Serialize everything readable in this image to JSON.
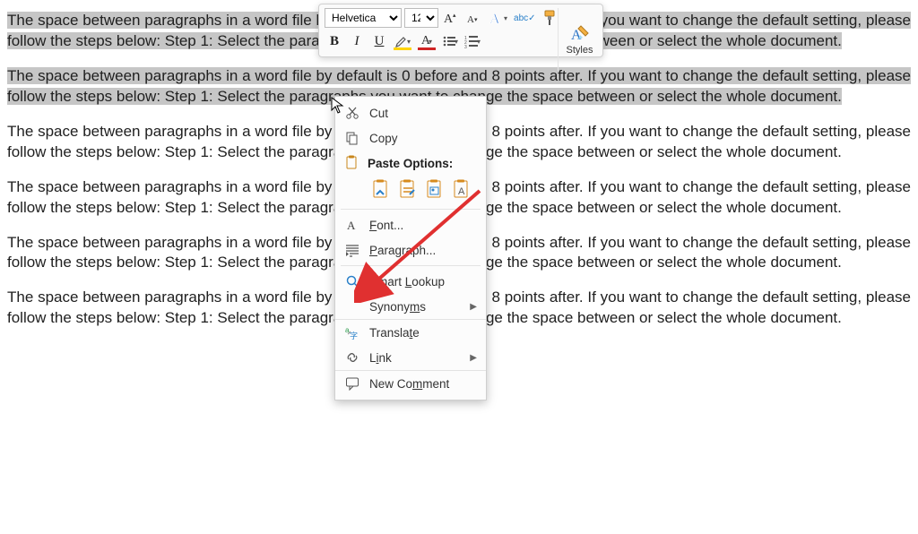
{
  "document": {
    "paragraph": "The space between paragraphs in a word file by default is 0 before and 8 points after. If you want to change the default setting, please follow the steps below: Step 1: Select the paragraphs you want to change the space between or select the whole document."
  },
  "miniToolbar": {
    "fontName": "Helvetica",
    "fontSize": "12",
    "stylesLabel": "Styles"
  },
  "contextMenu": {
    "cut": "Cut",
    "copy": "Copy",
    "pasteOptions": "Paste Options:",
    "font": "Font...",
    "paragraph": "Paragraph...",
    "smartLookup": "Smart Lookup",
    "synonyms": "Synonyms",
    "translate": "Translate",
    "link": "Link",
    "newComment": "New Comment"
  }
}
